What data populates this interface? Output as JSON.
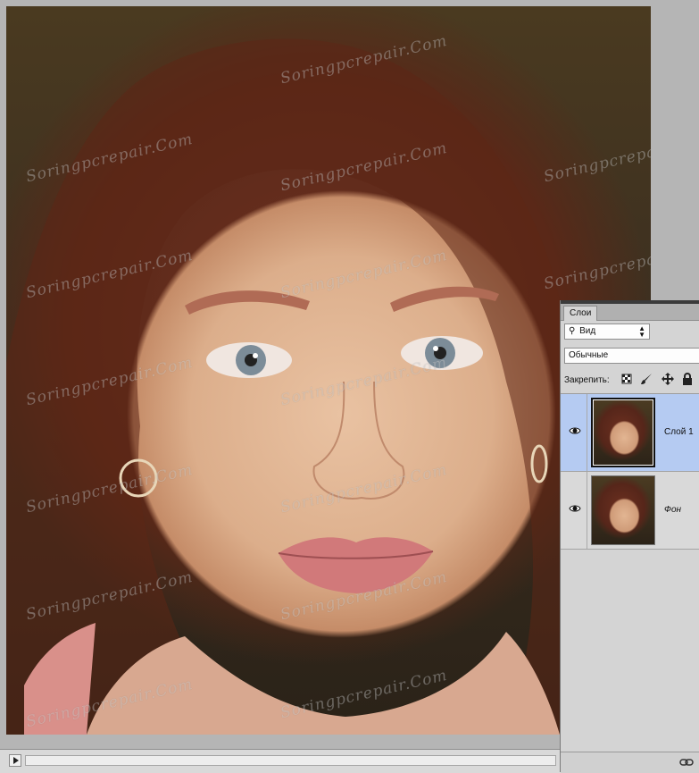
{
  "watermark": {
    "text": "Soringpcrepair.Com"
  },
  "layers_panel": {
    "tab_label": "Слои",
    "kind_filter": {
      "icon": "search-icon",
      "value": "Вид"
    },
    "blend_mode": {
      "value": "Обычные"
    },
    "lock_label": "Закрепить:",
    "lock_icons": [
      "lock-transparent-icon",
      "lock-paint-icon",
      "lock-position-icon",
      "lock-all-icon"
    ],
    "layers": [
      {
        "name": "Слой 1",
        "selected": true,
        "visible": true
      },
      {
        "name": "Фон",
        "selected": false,
        "visible": true
      }
    ],
    "footer_icons": [
      "link-icon"
    ]
  },
  "colors": {
    "selection": "#b5cbf2",
    "panel": "#d4d4d4"
  }
}
